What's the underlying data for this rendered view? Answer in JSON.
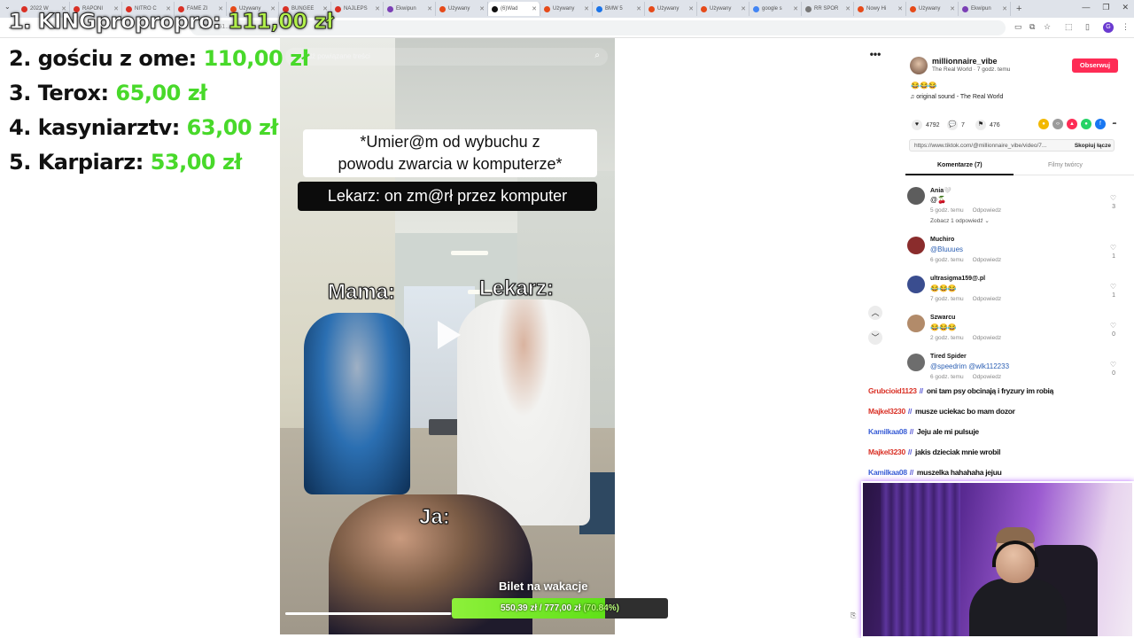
{
  "browser": {
    "tabs": [
      {
        "label": "2022 W",
        "color": "#d93025"
      },
      {
        "label": "RAPONI",
        "color": "#d93025"
      },
      {
        "label": "NITRO C",
        "color": "#d93025"
      },
      {
        "label": "FAME ZI",
        "color": "#d93025"
      },
      {
        "label": "Używany",
        "color": "#e64a19"
      },
      {
        "label": "BUNGEE",
        "color": "#d93025"
      },
      {
        "label": "NAJLEPS",
        "color": "#d93025"
      },
      {
        "label": "Ekwipun",
        "color": "#7b3fb5"
      },
      {
        "label": "Używany",
        "color": "#e64a19"
      },
      {
        "label": "(6)Wad",
        "color": "#111111",
        "active": true
      },
      {
        "label": "Używany",
        "color": "#e64a19"
      },
      {
        "label": "BMW 5",
        "color": "#1a73e8"
      },
      {
        "label": "Używany",
        "color": "#e64a19"
      },
      {
        "label": "Używany",
        "color": "#e64a19"
      },
      {
        "label": "google s",
        "color": "#4285f4"
      },
      {
        "label": "RR SPOR",
        "color": "#777777"
      },
      {
        "label": "Nowy Hi",
        "color": "#e64a19"
      },
      {
        "label": "Używany",
        "color": "#e64a19"
      },
      {
        "label": "Ekwipun",
        "color": "#7b3fb5"
      }
    ],
    "url_fragment": "3077.351..."
  },
  "leaderboard": [
    {
      "rank": "1.",
      "name": "KINGpropropro:",
      "amount": "111,00 zł"
    },
    {
      "rank": "2.",
      "name": "gościu z ome:",
      "amount": "110,00 zł"
    },
    {
      "rank": "3.",
      "name": "Terox:",
      "amount": "65,00 zł"
    },
    {
      "rank": "4.",
      "name": "kasyniarztv:",
      "amount": "63,00 zł"
    },
    {
      "rank": "5.",
      "name": "Karpiarz:",
      "amount": "53,00 zł"
    }
  ],
  "video": {
    "search_placeholder": "Znajdź powiązane treści",
    "caption_top_line1": "*Umier@m od wybuchu z",
    "caption_top_line2": "powodu zwarcia w komputerze*",
    "caption_second": "Lekarz: on zm@rł przez komputer",
    "label_mama": "Mama:",
    "label_lekarz": "Lekarz:",
    "label_ja": "Ja:",
    "progress": 0.52
  },
  "goal": {
    "title": "Bilet na wakacje",
    "current": "550,39 zł",
    "separator": "/",
    "target": "777,00 zł",
    "percent_text": "(70.84%)",
    "fraction": 0.7084
  },
  "post": {
    "author": "millionnaire_vibe",
    "subtitle": "The Real World · 7 godz. temu",
    "follow_label": "Obserwuj",
    "emojis": "😂😂😂",
    "sound": "♫  original sound - The Real World",
    "likes": "4792",
    "comments": "7",
    "saves": "476",
    "link": "https://www.tiktok.com/@millionnaire_vibe/video/7...",
    "copy_label": "Skopiuj łącze",
    "tab_comments": "Komentarze (7)",
    "tab_creator": "Filmy twórcy"
  },
  "comments": [
    {
      "name": "Ania🤍",
      "text": "@🍒",
      "meta": "5 godz. temu",
      "reply": "Odpowiedz",
      "likes": "3",
      "more": "Zobacz 1 odpowiedź ⌄",
      "mention": false,
      "avatar": "#5d5d5d"
    },
    {
      "name": "Muchiro",
      "text": "@Bluuues",
      "meta": "6 godz. temu",
      "reply": "Odpowiedz",
      "likes": "1",
      "more": "",
      "mention": true,
      "avatar": "#8a2c2c"
    },
    {
      "name": "ultrasigma159@.pl",
      "text": "😂😂😂",
      "meta": "7 godz. temu",
      "reply": "Odpowiedz",
      "likes": "1",
      "more": "",
      "mention": false,
      "avatar": "#3a4d8f"
    },
    {
      "name": "Szwarcu",
      "text": "😂😂😂",
      "meta": "2 godz. temu",
      "reply": "Odpowiedz",
      "likes": "0",
      "more": "",
      "mention": false,
      "avatar": "#b28b6a"
    },
    {
      "name": "Tired Spider",
      "text": "@speedrim @wlk112233",
      "meta": "6 godz. temu",
      "reply": "Odpowiedz",
      "likes": "0",
      "more": "",
      "mention": true,
      "avatar": "#6d6d6d"
    }
  ],
  "chat": [
    {
      "user": "Grubcioid1123",
      "color": "#d93025",
      "message": "oni tam psy obcinają i fryzury im robią"
    },
    {
      "user": "Majkel3230",
      "color": "#d93025",
      "message": "musze uciekac bo mam dozor"
    },
    {
      "user": "Kamilkaa08",
      "color": "#3b5fd6",
      "message": "Jeju ale mi pulsuje"
    },
    {
      "user": "Majkel3230",
      "color": "#d93025",
      "message": "jakis dzieciak mnie wrobil"
    },
    {
      "user": "Kamilkaa08",
      "color": "#3b5fd6",
      "message": "muszelka hahahaha jejuu"
    }
  ],
  "icons": {
    "more": "more-icon",
    "search": "search-icon",
    "arrow_up": "chevron-up-icon",
    "arrow_down": "chevron-down-icon"
  }
}
